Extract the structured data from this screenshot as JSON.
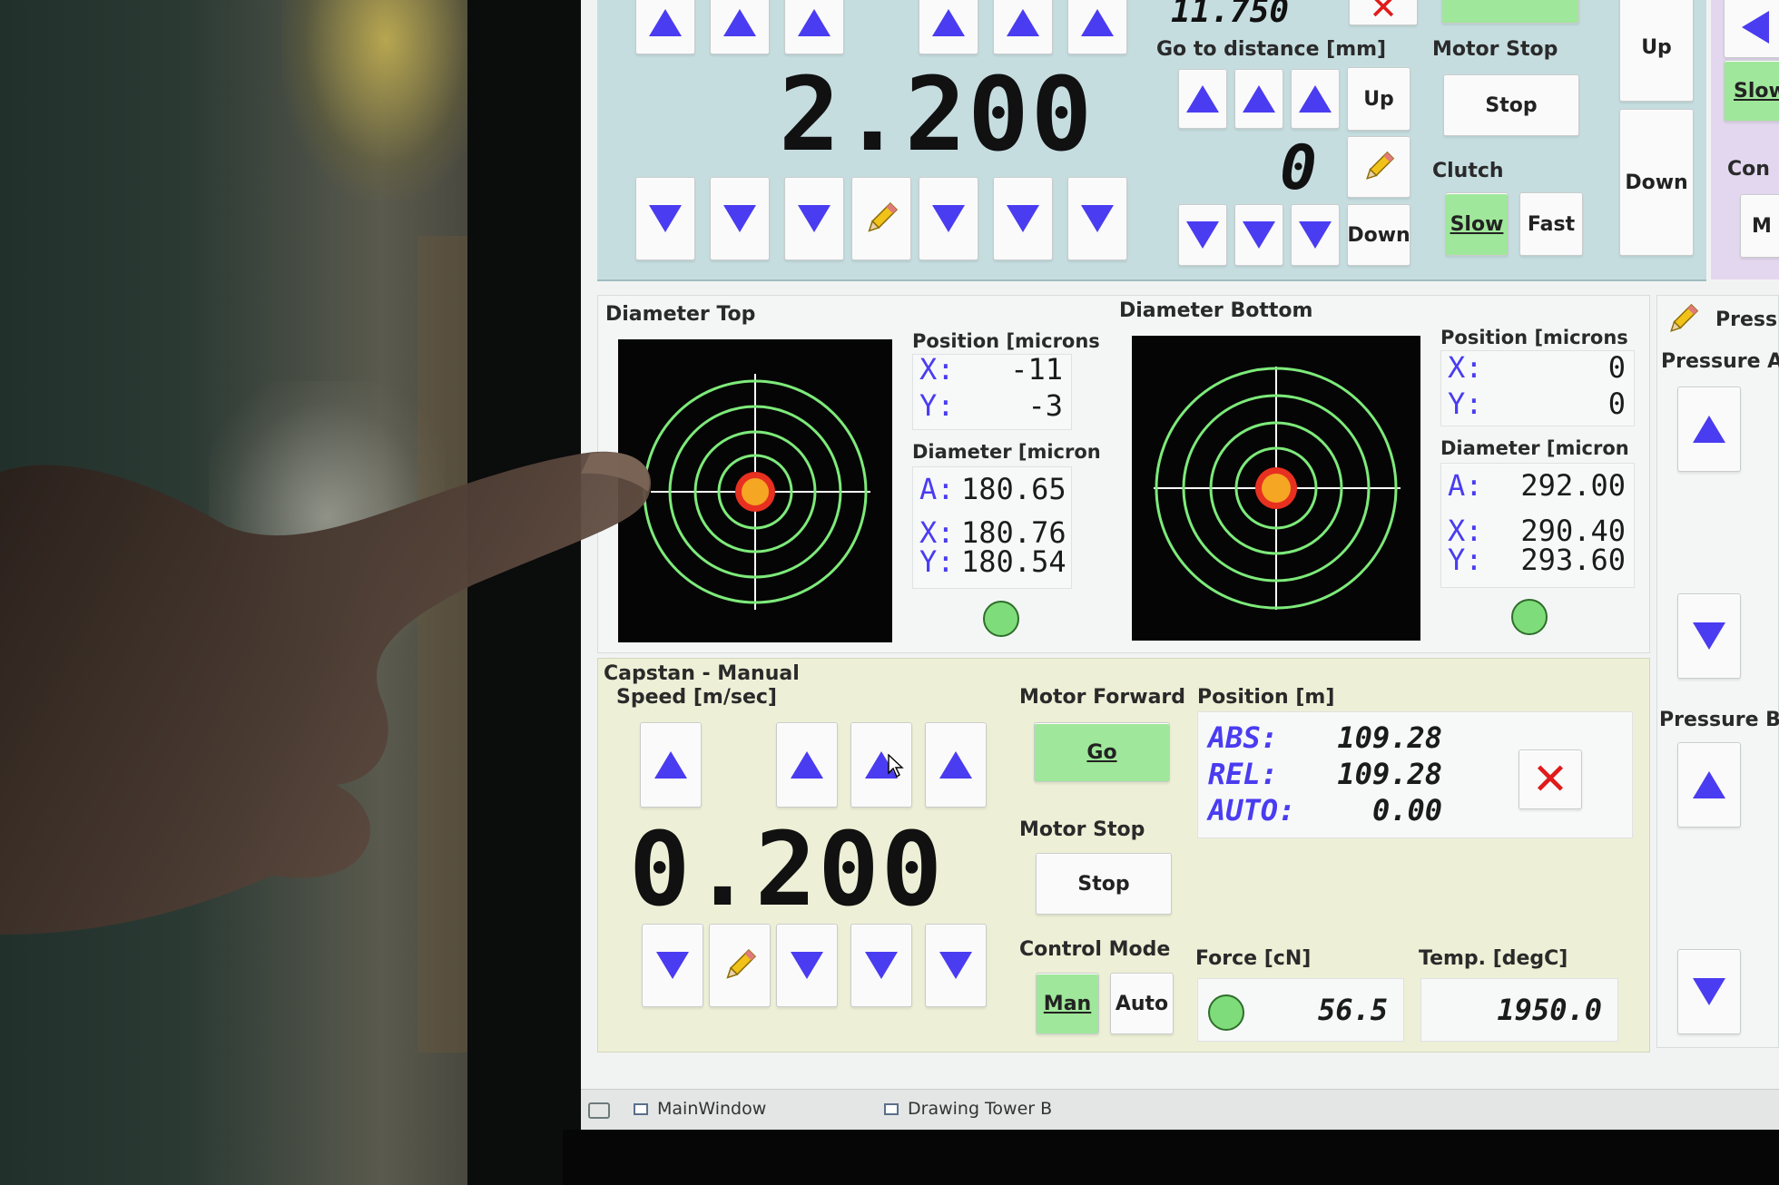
{
  "motor": {
    "position_value": "2.200",
    "distance_top": "11.750",
    "go_to_distance_label": "Go to distance [mm]",
    "go_to_value": "0",
    "up_label": "Up",
    "down_label": "Down",
    "motor_stop_label": "Motor Stop",
    "stop_label": "Stop",
    "clutch_label": "Clutch",
    "slow_label": "Slow",
    "fast_label": "Fast",
    "side_up_label": "Up",
    "side_down_label": "Down",
    "side_slow_label": "Slow",
    "side_con_label": "Con",
    "side_m_label": "M"
  },
  "diameter_top": {
    "title": "Diameter Top",
    "position_label": "Position [microns",
    "x_key": "X:",
    "x_value": "-11",
    "y_key": "Y:",
    "y_value": "-3",
    "diameter_label": "Diameter [micron",
    "a_key": "A:",
    "a_value": "180.65",
    "dx_key": "X:",
    "dx_value": "180.76",
    "dy_key": "Y:",
    "dy_value": "180.54"
  },
  "diameter_bottom": {
    "title": "Diameter Bottom",
    "position_label": "Position [microns",
    "x_key": "X:",
    "x_value": "0",
    "y_key": "Y:",
    "y_value": "0",
    "diameter_label": "Diameter [micron",
    "a_key": "A:",
    "a_value": "292.00",
    "dx_key": "X:",
    "dx_value": "290.40",
    "dy_key": "Y:",
    "dy_value": "293.60"
  },
  "capstan": {
    "title": "Capstan - Manual",
    "speed_label": "Speed [m/sec]",
    "speed_value": "0.200",
    "motor_forward_label": "Motor Forward",
    "go_label": "Go",
    "motor_stop_label": "Motor Stop",
    "stop_label": "Stop",
    "control_mode_label": "Control Mode",
    "man_label": "Man",
    "auto_label": "Auto",
    "position_label": "Position [m]",
    "abs_key": "ABS:",
    "abs_value": "109.28",
    "rel_key": "REL:",
    "rel_value": "109.28",
    "auto_key": "AUTO:",
    "auto_value": "0.00",
    "force_label": "Force [cN]",
    "force_value": "56.5",
    "temp_label": "Temp. [degC]",
    "temp_value": "1950.0"
  },
  "pressure": {
    "title": "Press",
    "a_label": "Pressure A",
    "b_label": "Pressure B"
  },
  "taskbar": {
    "item1": "MainWindow",
    "item2": "Drawing Tower B"
  },
  "colors": {
    "accent_arrow": "#4a3cf0",
    "active_green": "#9fe79a",
    "target_ring": "#7dea7a",
    "target_center": "#f5a623",
    "clear_red": "#e11b1b"
  }
}
